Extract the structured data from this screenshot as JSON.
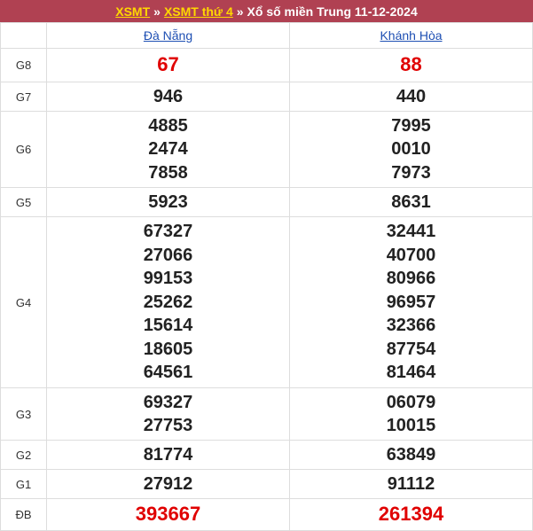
{
  "header": {
    "link1": "XSMT",
    "sep1": "»",
    "link2": "XSMT thứ 4",
    "sep2": "»",
    "title": "Xổ số miền Trung 11-12-2024"
  },
  "provinces": [
    "Đà Nẵng",
    "Khánh Hòa"
  ],
  "prizes": [
    {
      "label": "G8",
      "values": [
        [
          "67"
        ],
        [
          "88"
        ]
      ]
    },
    {
      "label": "G7",
      "values": [
        [
          "946"
        ],
        [
          "440"
        ]
      ]
    },
    {
      "label": "G6",
      "values": [
        [
          "4885",
          "2474",
          "7858"
        ],
        [
          "7995",
          "0010",
          "7973"
        ]
      ]
    },
    {
      "label": "G5",
      "values": [
        [
          "5923"
        ],
        [
          "8631"
        ]
      ]
    },
    {
      "label": "G4",
      "values": [
        [
          "67327",
          "27066",
          "99153",
          "25262",
          "15614",
          "18605",
          "64561"
        ],
        [
          "32441",
          "40700",
          "80966",
          "96957",
          "32366",
          "87754",
          "81464"
        ]
      ]
    },
    {
      "label": "G3",
      "values": [
        [
          "69327",
          "27753"
        ],
        [
          "06079",
          "10015"
        ]
      ]
    },
    {
      "label": "G2",
      "values": [
        [
          "81774"
        ],
        [
          "63849"
        ]
      ]
    },
    {
      "label": "G1",
      "values": [
        [
          "27912"
        ],
        [
          "91112"
        ]
      ]
    },
    {
      "label": "ĐB",
      "values": [
        [
          "393667"
        ],
        [
          "261394"
        ]
      ]
    }
  ],
  "colors": {
    "header_bg": "#b04152",
    "header_link": "#ffd800",
    "highlight": "#e00000",
    "province_link": "#1e4fb3"
  }
}
